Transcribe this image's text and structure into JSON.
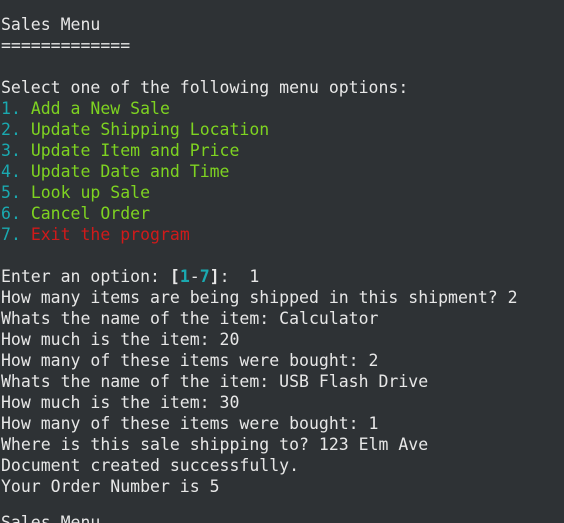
{
  "menu": {
    "title": "Sales Menu",
    "underline": "=============",
    "prompt": "Select one of the following menu options:",
    "options": [
      {
        "num": "1",
        "label": "Add a New Sale"
      },
      {
        "num": "2",
        "label": "Update Shipping Location"
      },
      {
        "num": "3",
        "label": "Update Item and Price"
      },
      {
        "num": "4",
        "label": "Update Date and Time"
      },
      {
        "num": "5",
        "label": "Look up Sale"
      },
      {
        "num": "6",
        "label": "Cancel Order"
      },
      {
        "num": "7",
        "label": "Exit the program"
      }
    ]
  },
  "input": {
    "prefix": "Enter an option: ",
    "range_open": "[",
    "range_low": "1",
    "range_dash": "-",
    "range_high": "7",
    "range_close": "]",
    "suffix": ":  ",
    "value": "1"
  },
  "transcript": [
    "How many items are being shipped in this shipment? 2",
    "Whats the name of the item: Calculator",
    "How much is the item: 20",
    "How many of these items were bought: 2",
    "Whats the name of the item: USB Flash Drive",
    "How much is the item: 30",
    "How many of these items were bought: 1",
    "Where is this sale shipping to? 123 Elm Ave",
    "Document created successfully.",
    "Your Order Number is 5"
  ],
  "cut_off_line": "Sales Menu",
  "colors": {
    "background": "#2e3235",
    "text": "#e7e7e7",
    "option_number": "#1aa9b0",
    "option_label": "#7ed321",
    "exit_label": "#d01a1a"
  }
}
